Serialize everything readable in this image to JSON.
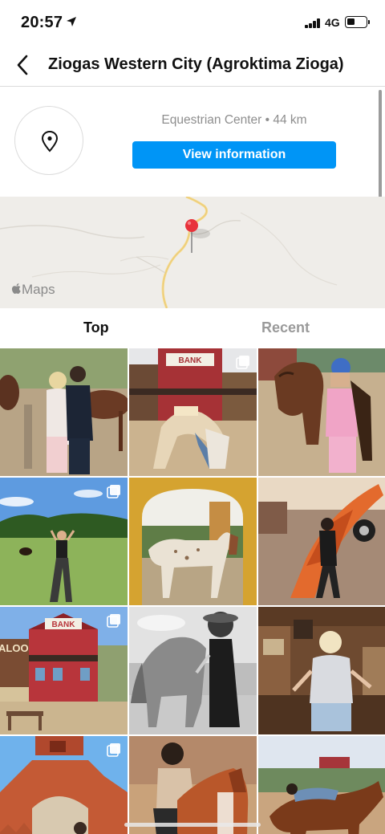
{
  "status_bar": {
    "time": "20:57",
    "network": "4G",
    "battery_level": 0.45,
    "signal_bars": 4
  },
  "nav": {
    "title": "Ziogas Western City (Agroktima Zioga)",
    "back_icon": "chevron-left-icon"
  },
  "location": {
    "category": "Equestrian Center • 44 km",
    "view_button": "View information",
    "icon": "location-pin-icon"
  },
  "map": {
    "credit": "Maps",
    "credit_icon": "apple-icon",
    "pin_color": "#e8323a"
  },
  "tabs": [
    {
      "label": "Top",
      "active": true
    },
    {
      "label": "Recent",
      "active": false
    }
  ],
  "posts": [
    {
      "id": 1,
      "subject": "two women with horse on farm",
      "multi": false
    },
    {
      "id": 2,
      "subject": "woman on saloon street with BANK sign",
      "multi": true,
      "sign_text": "BANK"
    },
    {
      "id": 3,
      "subject": "woman in pink with horse and helmet",
      "multi": false
    },
    {
      "id": 4,
      "subject": "woman in field with arms raised",
      "multi": true
    },
    {
      "id": 5,
      "subject": "white spotted horse in archway",
      "multi": false
    },
    {
      "id": 6,
      "subject": "woman posing at orange vintage car",
      "multi": false
    },
    {
      "id": 7,
      "subject": "saloon and bank buildings",
      "multi": true,
      "sign_text": "BANK",
      "saloon_text": "ALOON"
    },
    {
      "id": 8,
      "subject": "black and white woman with horse",
      "multi": false
    },
    {
      "id": 9,
      "subject": "blonde woman in saloon interior",
      "multi": false
    },
    {
      "id": 10,
      "subject": "woman at red adobe gate",
      "multi": true
    },
    {
      "id": 11,
      "subject": "woman riding chestnut horse",
      "multi": false
    },
    {
      "id": 12,
      "subject": "woman lying on brown horse",
      "multi": false
    }
  ],
  "colors": {
    "accent": "#0095f6",
    "inactive_tab": "#9a9a9a",
    "secondary_text": "#8e8e8e"
  }
}
